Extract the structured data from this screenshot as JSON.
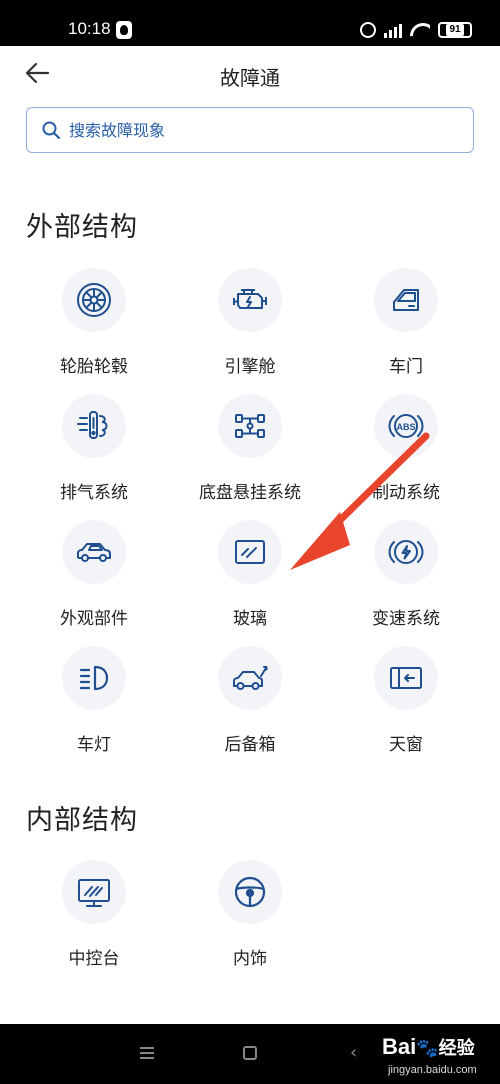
{
  "status_bar": {
    "time": "10:18",
    "battery": "91",
    "hd_label": "HD"
  },
  "header": {
    "title": "故障通"
  },
  "search": {
    "placeholder": "搜索故障现象"
  },
  "sections": [
    {
      "title": "外部结构",
      "items": [
        {
          "label": "轮胎轮毂",
          "icon": "wheel-icon"
        },
        {
          "label": "引擎舱",
          "icon": "engine-icon"
        },
        {
          "label": "车门",
          "icon": "car-door-icon"
        },
        {
          "label": "排气系统",
          "icon": "exhaust-icon"
        },
        {
          "label": "底盘悬挂系统",
          "icon": "chassis-icon"
        },
        {
          "label": "制动系统",
          "icon": "abs-brake-icon"
        },
        {
          "label": "外观部件",
          "icon": "car-exterior-icon"
        },
        {
          "label": "玻璃",
          "icon": "glass-icon"
        },
        {
          "label": "变速系统",
          "icon": "transmission-icon"
        },
        {
          "label": "车灯",
          "icon": "headlight-icon"
        },
        {
          "label": "后备箱",
          "icon": "trunk-icon"
        },
        {
          "label": "天窗",
          "icon": "sunroof-icon"
        }
      ]
    },
    {
      "title": "内部结构",
      "items": [
        {
          "label": "中控台",
          "icon": "center-console-icon"
        },
        {
          "label": "内饰",
          "icon": "steering-wheel-icon"
        }
      ]
    }
  ],
  "watermark": {
    "brand": "Bai",
    "brand_suffix": "经验",
    "url": "jingyan.baidu.com"
  },
  "colors": {
    "icon_blue": "#1f4f8f",
    "accent_blue": "#2a5fa9",
    "arrow_red": "#e8452c",
    "icon_bg": "#f2f4f8"
  }
}
